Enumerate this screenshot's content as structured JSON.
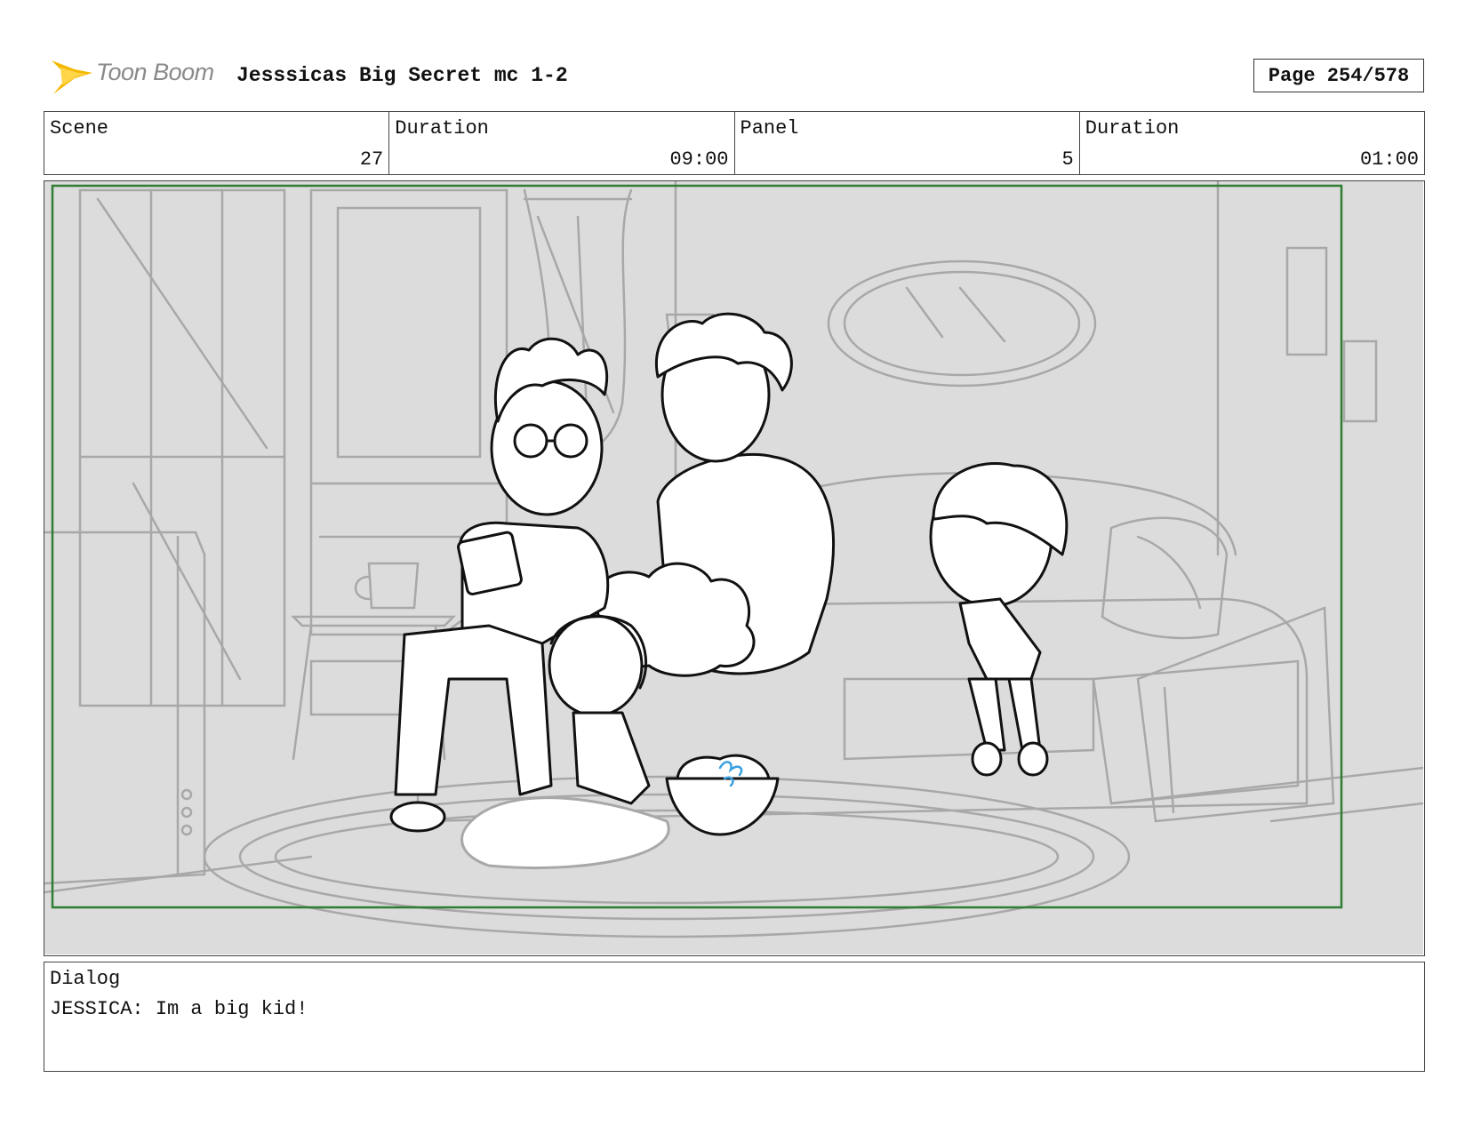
{
  "header": {
    "logo_text": "Toon Boom",
    "title": "Jesssicas Big Secret mc 1-2",
    "page": "Page 254/578"
  },
  "info": {
    "scene_label": "Scene",
    "scene_value": "27",
    "duration_label": "Duration",
    "duration_value": "09:00",
    "panel_label": "Panel",
    "panel_value": "5",
    "panel_duration_label": "Duration",
    "panel_duration_value": "01:00"
  },
  "dialog": {
    "label": "Dialog",
    "text": "JESSICA: Im a big kid!"
  },
  "colors": {
    "logo_star": "#f5b800",
    "safe_frame": "#2e7d32",
    "background_gray": "#dcdcdc",
    "sketch_line": "#a8a8a8",
    "character_line": "#111111",
    "popcorn_blue": "#3aa0e0"
  }
}
